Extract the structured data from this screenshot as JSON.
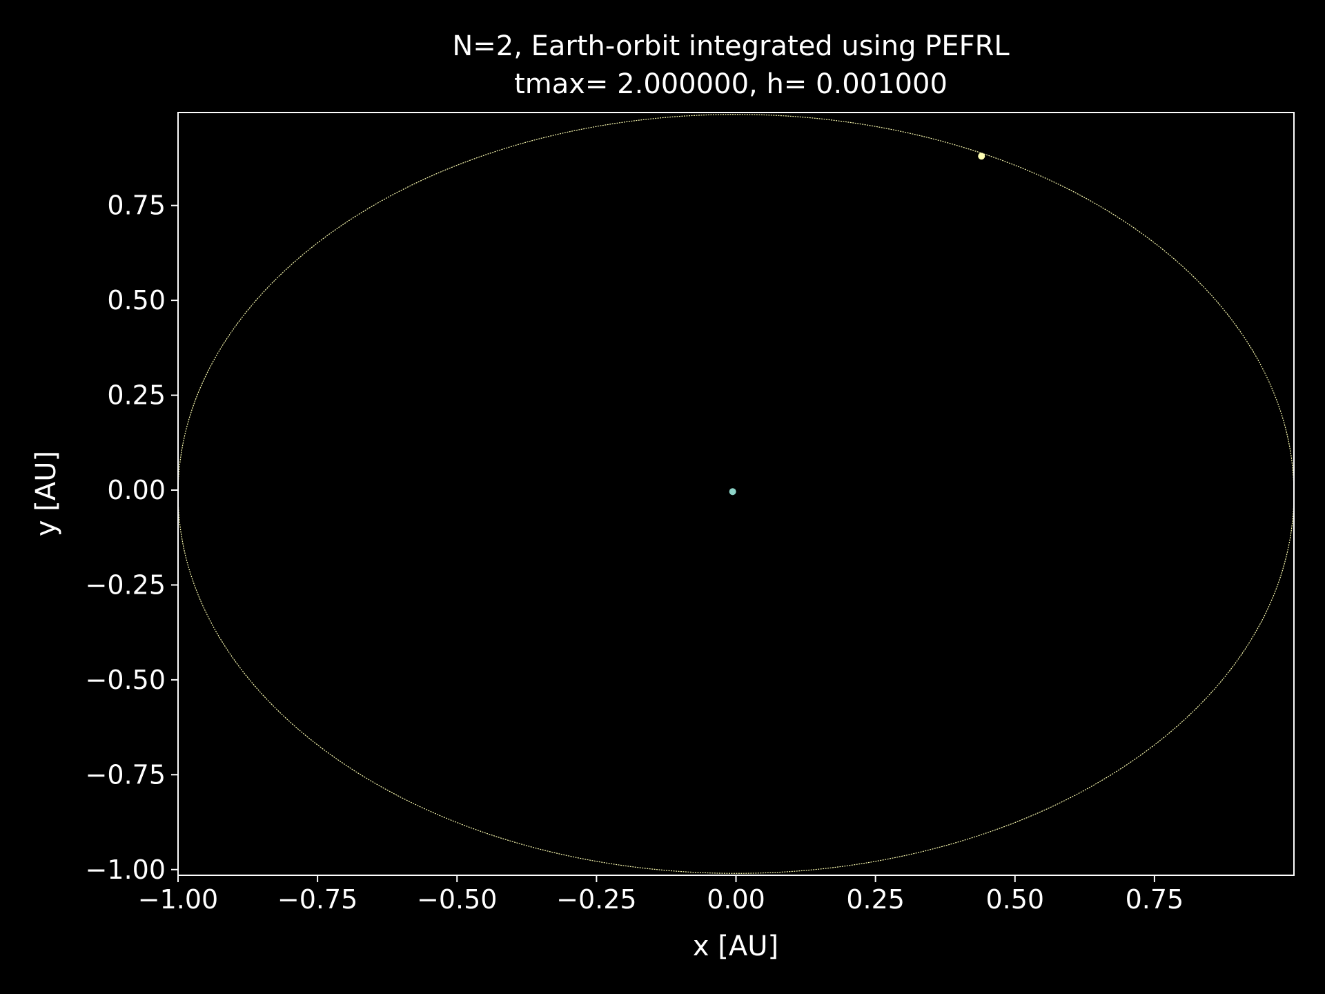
{
  "chart_data": {
    "type": "scatter",
    "title": "N=2, Earth-orbit integrated using PEFRL",
    "subtitle": "tmax= 2.000000, h= 0.001000",
    "xlabel": "x [AU]",
    "ylabel": "y [AU]",
    "xlim": [
      -1.0,
      1.0
    ],
    "ylim": [
      -1.015,
      0.995
    ],
    "x_ticks": [
      -1.0,
      -0.75,
      -0.5,
      -0.25,
      0.0,
      0.25,
      0.5,
      0.75
    ],
    "x_tick_labels": [
      "−1.00",
      "−0.75",
      "−0.50",
      "−0.25",
      "0.00",
      "0.25",
      "0.50",
      "0.75"
    ],
    "y_ticks": [
      -1.0,
      -0.75,
      -0.5,
      -0.25,
      0.0,
      0.25,
      0.5,
      0.75
    ],
    "y_tick_labels": [
      "−1.00",
      "−0.75",
      "−0.50",
      "−0.25",
      "0.00",
      "0.25",
      "0.50",
      "0.75"
    ],
    "grid": false,
    "background": "#000000",
    "orbit": {
      "center": [
        0.0,
        -0.01
      ],
      "radius_x": 1.0,
      "radius_y": 1.0,
      "color": "#ffffb3"
    },
    "series": [
      {
        "x": [
          -0.006
        ],
        "y": [
          -0.004
        ],
        "color": "#8dd3c7"
      },
      {
        "x": [
          0.44
        ],
        "y": [
          0.88
        ],
        "color": "#ffffb3"
      }
    ]
  }
}
